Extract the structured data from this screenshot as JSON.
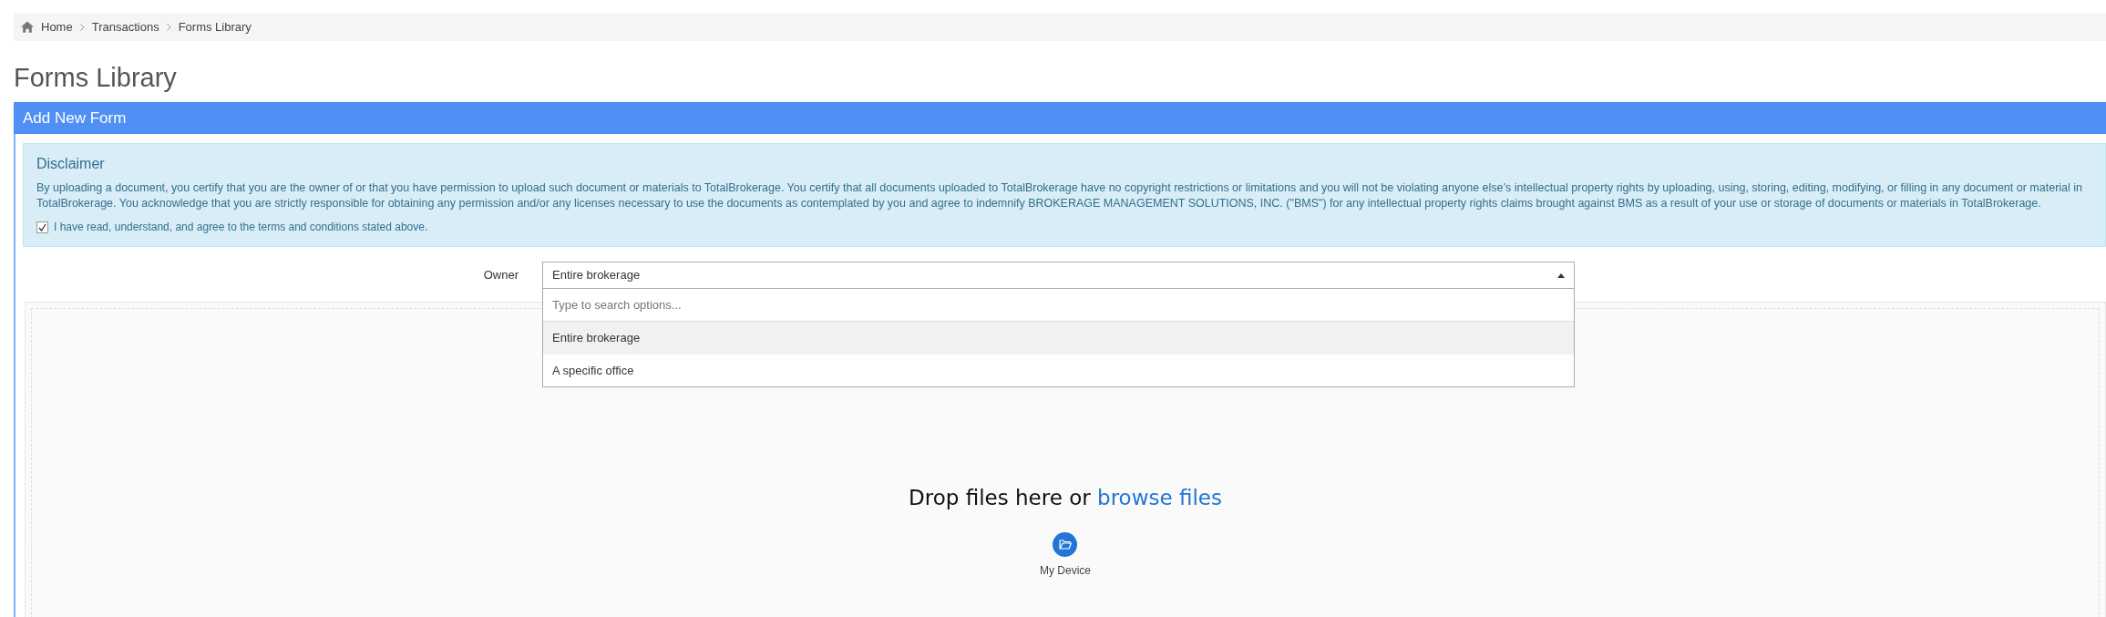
{
  "breadcrumb": [
    {
      "label": "Home",
      "kind": "home"
    },
    {
      "label": "Transactions",
      "kind": "link"
    },
    {
      "label": "Forms Library",
      "kind": "current"
    }
  ],
  "page_title": "Forms Library",
  "panel": {
    "title": "Add New Form",
    "disclaimer": {
      "title": "Disclaimer",
      "text": "By uploading a document, you certify that you are the owner of or that you have permission to upload such document or materials to TotalBrokerage. You certify that all documents uploaded to TotalBrokerage have no copyright restrictions or limitations and you will not be violating anyone else’s intellectual property rights by uploading, using, storing, editing, modifying, or filling in any document or material in TotalBrokerage. You acknowledge that you are strictly responsible for obtaining any permission and/or any licenses necessary to use the documents as contemplated by you and agree to indemnify BROKERAGE MANAGEMENT SOLUTIONS, INC. (\"BMS\") for any intellectual property rights claims brought against BMS as a result of your use or storage of documents or materials in TotalBrokerage.",
      "agree_label": "I have read, understand, and agree to the terms and conditions stated above.",
      "checked": true
    },
    "owner": {
      "label": "Owner",
      "value": "Entire brokerage",
      "expanded": true,
      "search_placeholder": "Type to search options...",
      "options": [
        {
          "label": "Entire brokerage",
          "selected": true
        },
        {
          "label": "A specific office",
          "selected": false
        }
      ]
    },
    "dropzone": {
      "text": "Drop files here or",
      "link": "browse files",
      "source": "My Device"
    }
  }
}
